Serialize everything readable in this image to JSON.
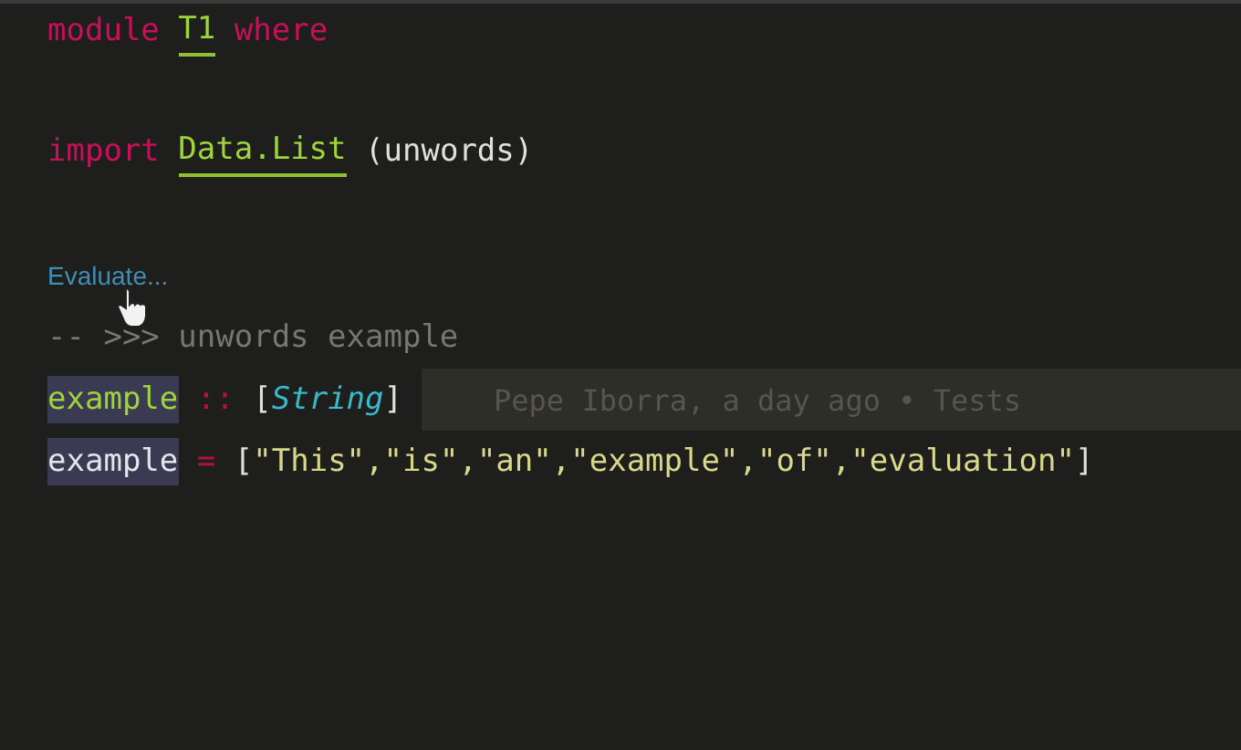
{
  "lines": [
    {
      "kind": "code",
      "words": [
        [
          {
            "text": "module",
            "kind": "keyword"
          }
        ],
        [
          {
            "text": "T1",
            "kind": "module"
          }
        ],
        [
          {
            "text": "where",
            "kind": "keyword"
          }
        ]
      ]
    },
    {
      "kind": "code"
    },
    {
      "kind": "code",
      "words": [
        [
          {
            "text": "import",
            "kind": "keyword"
          }
        ],
        [
          {
            "text": "Data.List",
            "kind": "module"
          }
        ],
        [
          {
            "text": "(unwords)",
            "kind": "plain"
          }
        ]
      ]
    },
    {
      "kind": "code"
    },
    {
      "kind": "lens",
      "text": "Evaluate..."
    },
    {
      "kind": "code",
      "words": [
        [
          {
            "text": "-- >>> unwords example",
            "kind": "comment"
          }
        ]
      ]
    },
    {
      "kind": "code",
      "current": true,
      "blame": "Pepe Iborra, a day ago • Tests",
      "words": [
        [
          {
            "text": "example",
            "kind": "definition"
          }
        ],
        [
          {
            "text": "::",
            "kind": "operator"
          }
        ],
        [
          {
            "text": "[",
            "kind": "punct"
          },
          {
            "text": "String",
            "kind": "type"
          },
          {
            "text": "]",
            "kind": "punct"
          }
        ]
      ]
    },
    {
      "kind": "code",
      "words": [
        [
          {
            "text": "example",
            "kind": "reference"
          }
        ],
        [
          {
            "text": "=",
            "kind": "operator"
          }
        ],
        [
          {
            "text": "[",
            "kind": "punct"
          },
          {
            "text": "\"This\",\"is\",\"an\",\"example\",\"of\",\"evaluation\"",
            "kind": "string"
          },
          {
            "text": "]",
            "kind": "punct"
          }
        ]
      ]
    }
  ]
}
